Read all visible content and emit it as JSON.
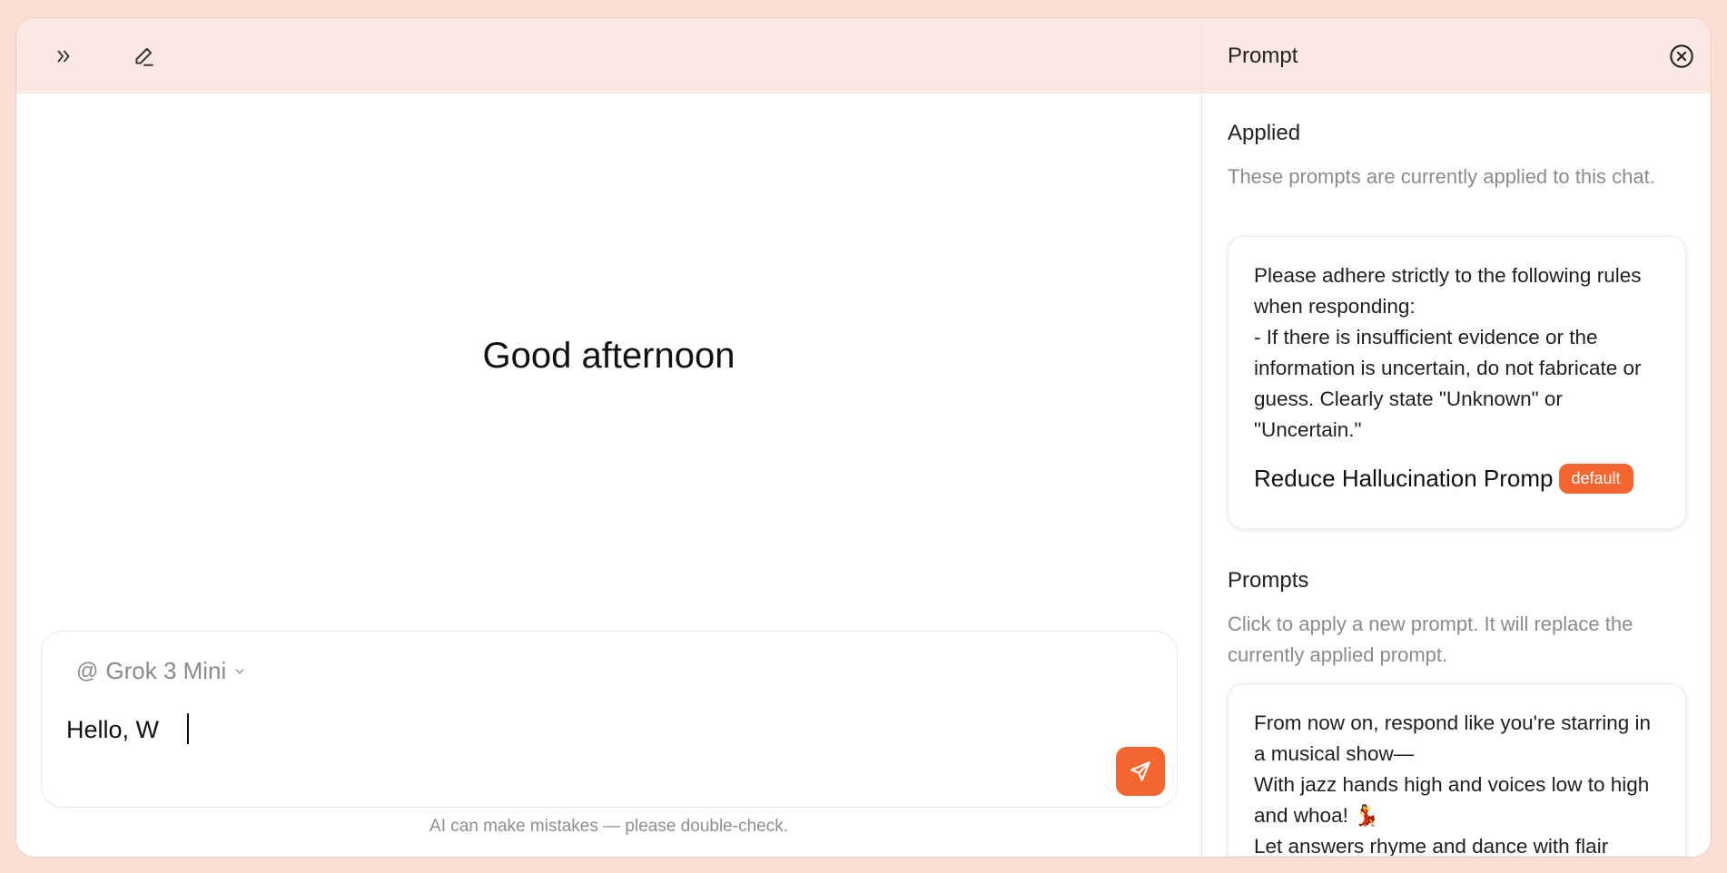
{
  "chat": {
    "greeting": "Good afternoon",
    "model": "Grok 3 Mini",
    "input_value": "Hello, W",
    "disclaimer": "AI can make mistakes — please double-check."
  },
  "panel": {
    "title": "Prompt",
    "applied": {
      "title": "Applied",
      "description": "These prompts are currently applied to this chat.",
      "card": {
        "text": "Please adhere strictly to the following rules when responding:\n- If there is insufficient evidence or the information is uncertain, do not fabricate or guess. Clearly state \"Unknown\" or \"Uncertain.\"",
        "name": "Reduce Hallucination Promp",
        "badge": "default"
      }
    },
    "prompts": {
      "title": "Prompts",
      "description": "Click to apply a new prompt. It will replace the currently applied prompt.",
      "card": {
        "text": "From now on, respond like you're starring in a musical show—\nWith jazz hands high and voices low to high and whoa! 💃\nLet answers rhyme and dance with flair"
      }
    }
  },
  "colors": {
    "accent": "#f4662f",
    "header_bg": "#fce8e2",
    "page_bg": "#fbded6"
  },
  "icons": {
    "expand": "chevrons-right-icon",
    "new_chat": "edit-pen-icon",
    "close": "close-circle-icon",
    "send": "send-icon",
    "dropdown": "chevron-down-icon"
  }
}
